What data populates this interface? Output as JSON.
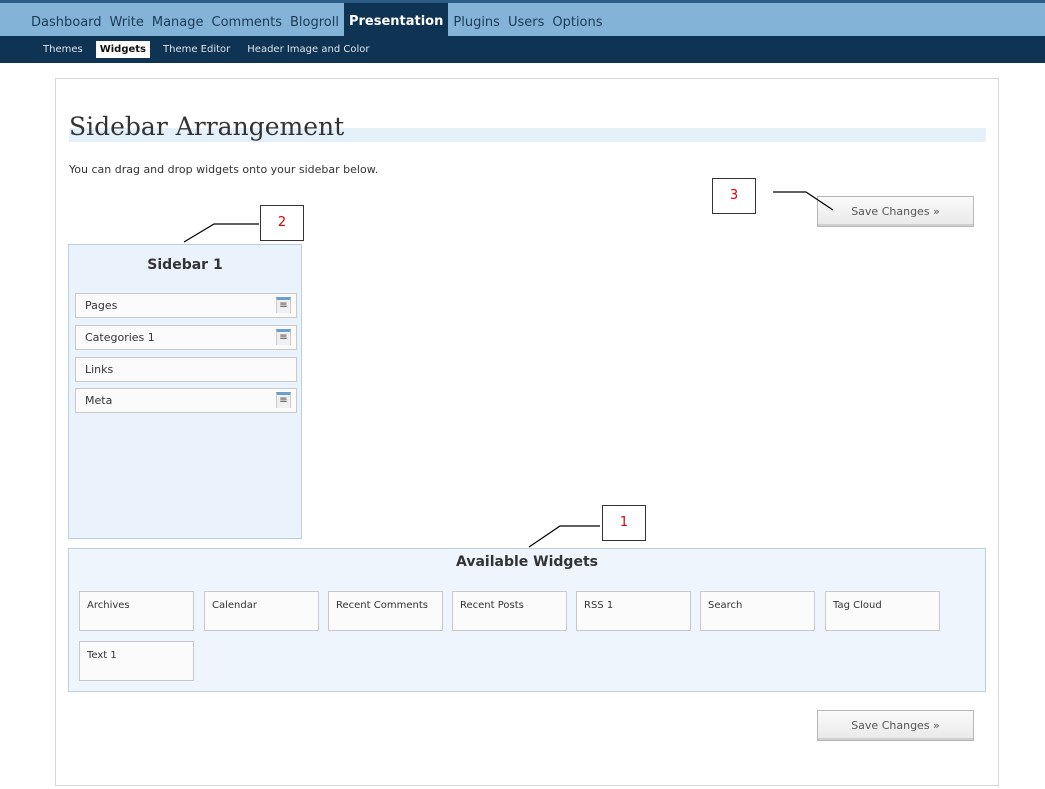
{
  "top_nav": [
    "Dashboard",
    "Write",
    "Manage",
    "Comments",
    "Blogroll",
    "Presentation",
    "Plugins",
    "Users",
    "Options"
  ],
  "top_nav_active": "Presentation",
  "sub_nav": [
    "Themes",
    "Widgets",
    "Theme Editor",
    "Header Image and Color"
  ],
  "sub_nav_active": "Widgets",
  "page": {
    "title": "Sidebar Arrangement",
    "intro": "You can drag and drop widgets onto your sidebar below.",
    "save_label": "Save Changes »"
  },
  "sidebar": {
    "title": "Sidebar 1",
    "widgets": [
      "Pages",
      "Categories 1",
      "Links",
      "Meta"
    ],
    "handle_glyph": "≡"
  },
  "available": {
    "title": "Available Widgets",
    "widgets": [
      "Archives",
      "Calendar",
      "Recent Comments",
      "Recent Posts",
      "RSS 1",
      "Search",
      "Tag Cloud",
      "Text 1"
    ]
  },
  "callouts": [
    "1",
    "2",
    "3"
  ],
  "colors": {
    "nav_bg": "#83b4d8",
    "nav_active": "#0f3352",
    "panel_bg": "#eaf3fb",
    "callout_text": "#e00000"
  }
}
